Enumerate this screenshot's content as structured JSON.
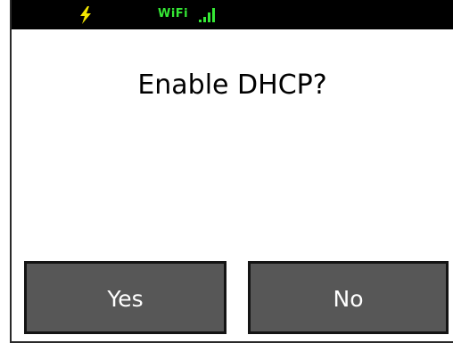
{
  "status_bar": {
    "power_icon": "lightning-bolt-icon",
    "wifi_label": "WiFi",
    "signal_icon": "signal-bars-icon",
    "accent_color": "#35e835",
    "bolt_color": "#f2e600"
  },
  "dialog": {
    "prompt": "Enable DHCP?",
    "yes_label": "Yes",
    "no_label": "No"
  }
}
